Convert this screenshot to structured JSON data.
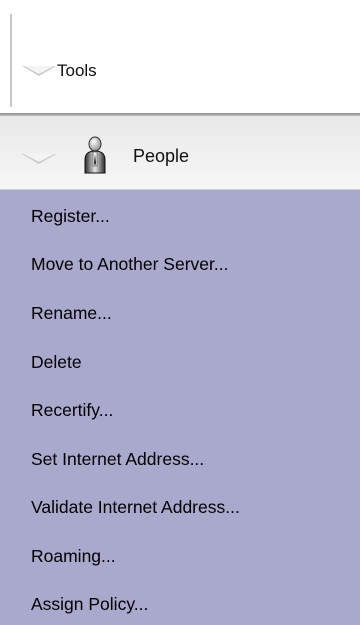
{
  "tools_section": {
    "label": "Tools"
  },
  "people_section": {
    "label": "People",
    "icon": "person-icon"
  },
  "menu": {
    "items": [
      {
        "label": "Register..."
      },
      {
        "label": "Move to Another Server..."
      },
      {
        "label": "Rename..."
      },
      {
        "label": "Delete"
      },
      {
        "label": "Recertify..."
      },
      {
        "label": "Set Internet Address..."
      },
      {
        "label": "Validate Internet Address..."
      },
      {
        "label": "Roaming..."
      },
      {
        "label": "Assign Policy..."
      }
    ]
  },
  "colors": {
    "menu_background": "#a9a8cd",
    "header_background": "#ececec"
  }
}
